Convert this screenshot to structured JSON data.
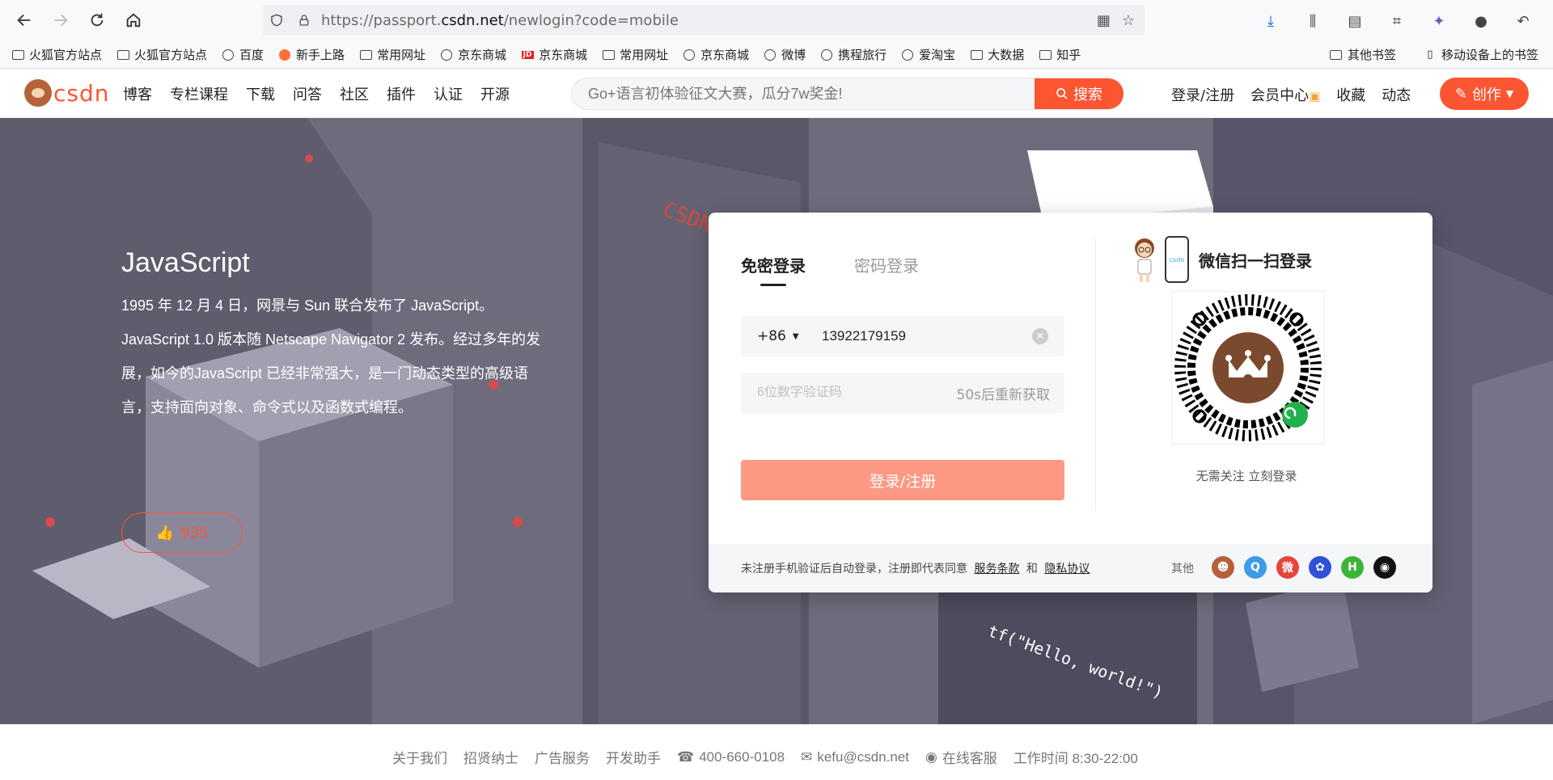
{
  "browser": {
    "url_prefix": "https://passport.",
    "url_domain": "csdn.net",
    "url_suffix": "/newlogin?code=mobile",
    "bookmarks": [
      {
        "label": "火狐官方站点",
        "icon": "folder"
      },
      {
        "label": "火狐官方站点",
        "icon": "folder"
      },
      {
        "label": "百度",
        "icon": "globe"
      },
      {
        "label": "新手上路",
        "icon": "firefox"
      },
      {
        "label": "常用网址",
        "icon": "folder"
      },
      {
        "label": "京东商城",
        "icon": "globe"
      },
      {
        "label": "京东商城",
        "icon": "jd"
      },
      {
        "label": "常用网址",
        "icon": "folder"
      },
      {
        "label": "京东商城",
        "icon": "globe"
      },
      {
        "label": "微博",
        "icon": "globe"
      },
      {
        "label": "携程旅行",
        "icon": "globe"
      },
      {
        "label": "爱淘宝",
        "icon": "globe"
      },
      {
        "label": "大数据",
        "icon": "folder"
      },
      {
        "label": "知乎",
        "icon": "folder"
      }
    ],
    "bookmarks_right": [
      "其他书签",
      "移动设备上的书签"
    ]
  },
  "header": {
    "logo_text": "csdn",
    "nav": [
      "博客",
      "专栏课程",
      "下载",
      "问答",
      "社区",
      "插件",
      "认证",
      "开源"
    ],
    "search_placeholder": "Go+语言初体验征文大赛，瓜分7w奖金!",
    "search_button": "搜索",
    "right_links": [
      "登录/注册",
      "会员中心",
      "收藏",
      "动态"
    ],
    "create_button": "创作"
  },
  "hero": {
    "title": "JavaScript",
    "description": "1995 年 12 月 4 日，网景与 Sun 联合发布了 JavaScript。JavaScript 1.0 版本随 Netscape Navigator 2 发布。经过多年的发展，如今的JavaScript 已经非常强大，是一门动态类型的高级语言，支持面向对象、命令式以及函数式编程。",
    "likes": "935"
  },
  "login": {
    "tabs": [
      "免密登录",
      "密码登录"
    ],
    "country_code": "+86",
    "phone_value": "13922179159",
    "code_placeholder": "6位数字验证码",
    "resend_text": "50s后重新获取",
    "submit_label": "登录/注册",
    "wechat_title": "微信扫一扫登录",
    "qr_tip": "无需关注 立刻登录",
    "agreement_prefix": "未注册手机验证后自动登录，注册即代表同意",
    "terms_link": "服务条款",
    "and_text": "和",
    "privacy_link": "隐私协议",
    "others_label": "其他"
  },
  "footer": {
    "links": [
      "关于我们",
      "招贤纳士",
      "广告服务",
      "开发助手"
    ],
    "phone": "400-660-0108",
    "email": "kefu@csdn.net",
    "service": "在线客服",
    "hours": "工作时间 8:30-22:00"
  },
  "colors": {
    "brand": "#fc5531",
    "hero_bg": "#6e6b7d"
  }
}
